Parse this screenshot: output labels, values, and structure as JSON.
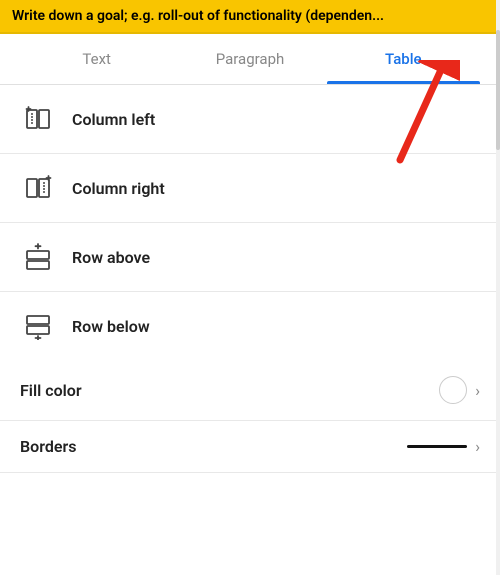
{
  "topbar": {
    "text": "Write down a goal; e.g. roll-out of functionality (dependen..."
  },
  "tabs": [
    {
      "id": "text",
      "label": "Text",
      "active": false
    },
    {
      "id": "paragraph",
      "label": "Paragraph",
      "active": false
    },
    {
      "id": "table",
      "label": "Table",
      "active": true
    }
  ],
  "menuItems": [
    {
      "id": "column-left",
      "label": "Column left",
      "icon": "column-left-icon"
    },
    {
      "id": "column-right",
      "label": "Column right",
      "icon": "column-right-icon"
    },
    {
      "id": "row-above",
      "label": "Row above",
      "icon": "row-above-icon"
    },
    {
      "id": "row-below",
      "label": "Row below",
      "icon": "row-below-icon"
    }
  ],
  "fillColor": {
    "label": "Fill color",
    "chevron": "›"
  },
  "borders": {
    "label": "Borders",
    "chevron": "›"
  },
  "colors": {
    "accent": "#1a73e8",
    "activeTab": "#1a73e8",
    "arrow": "#e8281a"
  }
}
